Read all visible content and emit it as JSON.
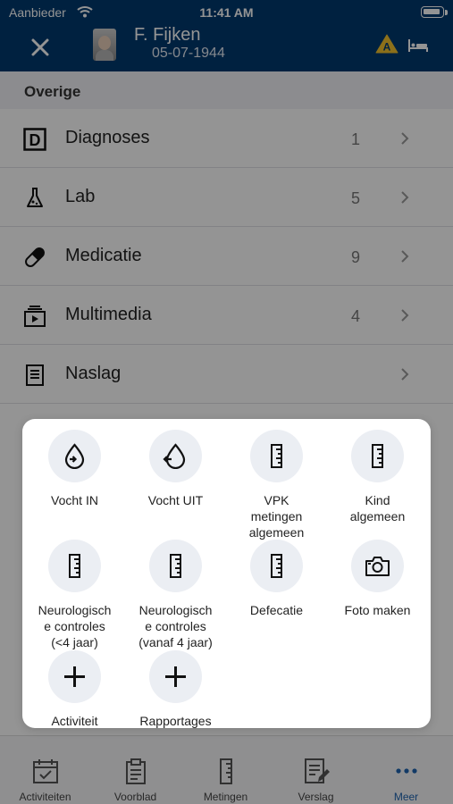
{
  "status": {
    "carrier": "Aanbieder",
    "time": "11:41 AM"
  },
  "patient": {
    "name": "F. Fijken",
    "dob": "05-07-1944",
    "alert_letter": "A"
  },
  "section": {
    "title": "Overige"
  },
  "rows": [
    {
      "label": "Diagnoses",
      "count": "1",
      "icon": "d-box-icon"
    },
    {
      "label": "Lab",
      "count": "5",
      "icon": "flask-icon"
    },
    {
      "label": "Medicatie",
      "count": "9",
      "icon": "pill-icon"
    },
    {
      "label": "Multimedia",
      "count": "4",
      "icon": "media-icon"
    },
    {
      "label": "Naslag",
      "count": "",
      "icon": "document-icon"
    }
  ],
  "actions": [
    {
      "label": "Vocht IN",
      "icon": "drop-in-icon"
    },
    {
      "label": "Vocht UIT",
      "icon": "drop-out-icon"
    },
    {
      "label": "VPK\nmetingen\nalgemeen",
      "icon": "ruler-icon"
    },
    {
      "label": "Kind\nalgemeen",
      "icon": "ruler-icon"
    },
    {
      "label": "Neurologisch\ne controles\n(<4 jaar)",
      "icon": "ruler-icon"
    },
    {
      "label": "Neurologisch\ne controles\n(vanaf 4 jaar)",
      "icon": "ruler-icon"
    },
    {
      "label": "Defecatie",
      "icon": "ruler-icon"
    },
    {
      "label": "Foto maken",
      "icon": "camera-icon"
    },
    {
      "label": "Activiteit",
      "icon": "plus-icon"
    },
    {
      "label": "Rapportages",
      "icon": "plus-icon"
    }
  ],
  "tabs": [
    {
      "label": "Activiteiten",
      "icon": "calendar-check-icon"
    },
    {
      "label": "Voorblad",
      "icon": "clipboard-icon"
    },
    {
      "label": "Metingen",
      "icon": "ruler-icon"
    },
    {
      "label": "Verslag",
      "icon": "edit-document-icon"
    },
    {
      "label": "Meer",
      "icon": "more-icon",
      "active": true
    }
  ],
  "colors": {
    "header": "#003a6e",
    "accent": "#1f64b0",
    "alert": "#f2c12e"
  }
}
